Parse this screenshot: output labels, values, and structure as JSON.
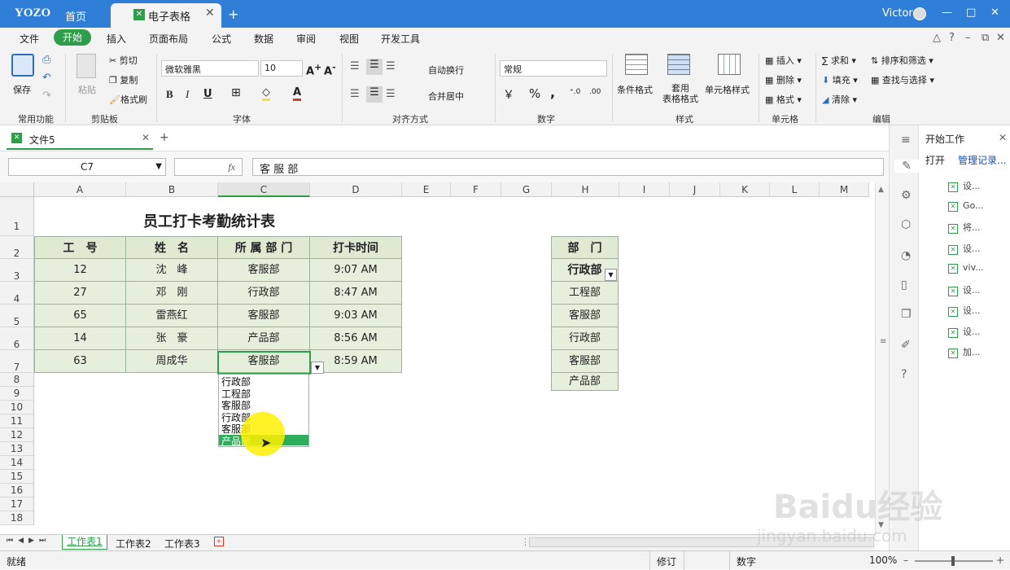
{
  "titlebar": {
    "logo": "YOZO",
    "home": "首页",
    "doc_tab": "电子表格",
    "new_tab": "+",
    "user": "Victor",
    "min": "—",
    "max": "□",
    "close": "✕"
  },
  "menu": {
    "items": [
      "文件",
      "开始",
      "插入",
      "页面布局",
      "公式",
      "数据",
      "审阅",
      "视图",
      "开发工具"
    ]
  },
  "ribbon": {
    "save": "保存",
    "paste": "粘贴",
    "cut": "剪切",
    "copy": "复制",
    "format_painter": "格式刷",
    "font_name": "微软雅黑",
    "font_size": "10",
    "bold": "B",
    "italic": "I",
    "underline": "U",
    "wrap": "自动换行",
    "merge": "合并居中",
    "number_format": "常规",
    "percent": "%",
    "comma": ",",
    "cond_format": "条件格式",
    "table_style": "套用\n表格格式",
    "cell_style": "单元格样式",
    "insert": "插入",
    "delete": "删除",
    "format": "格式",
    "sum": "求和",
    "fill": "填充",
    "clear": "清除",
    "sort": "排序和筛选",
    "find": "查找与选择",
    "groups": [
      "常用功能",
      "剪贴板",
      "字体",
      "对齐方式",
      "数字",
      "样式",
      "单元格",
      "编辑"
    ]
  },
  "filetab": {
    "name": "文件5",
    "close": "✕",
    "add": "+"
  },
  "formula": {
    "cellref": "C7",
    "fx": "fx",
    "value": "客 服 部"
  },
  "grid": {
    "columns": [
      "A",
      "B",
      "C",
      "D",
      "E",
      "F",
      "G",
      "H",
      "I",
      "J",
      "K",
      "L",
      "M"
    ],
    "rows": [
      "1",
      "2",
      "3",
      "4",
      "5",
      "6",
      "7",
      "8",
      "9",
      "10",
      "11",
      "12",
      "13",
      "14",
      "15",
      "16",
      "17",
      "18"
    ],
    "title": "员工打卡考勤统计表",
    "headers": [
      "工　号",
      "姓　名",
      "所 属 部 门",
      "打卡时间"
    ],
    "data": [
      [
        "12",
        "沈　峰",
        "客服部",
        "9:07 AM"
      ],
      [
        "27",
        "邓　刚",
        "行政部",
        "8:47 AM"
      ],
      [
        "65",
        "雷燕红",
        "客服部",
        "9:03 AM"
      ],
      [
        "14",
        "张　豪",
        "产品部",
        "8:56 AM"
      ],
      [
        "63",
        "周成华",
        "客服部",
        "8:59 AM"
      ]
    ],
    "dept_header": "部　门",
    "dept_list": [
      "行政部",
      "工程部",
      "客服部",
      "行政部",
      "客服部",
      "产品部"
    ]
  },
  "dropdown": {
    "items": [
      "行政部",
      "工程部",
      "客服部",
      "行政部",
      "客服部",
      "产品部"
    ],
    "selected_index": 5
  },
  "panel": {
    "title": "开始工作",
    "open": "打开",
    "manage": "管理记录...",
    "items": [
      "设...",
      "Go...",
      "将...",
      "设...",
      "viv...",
      "设...",
      "设...",
      "设...",
      "加..."
    ]
  },
  "sheets": [
    "工作表1",
    "工作表2",
    "工作表3"
  ],
  "status": {
    "ready": "就绪",
    "revise": "修订",
    "number": "数字",
    "zoom": "100%"
  },
  "watermark": {
    "text": "Baidu经验",
    "url": "jingyan.baidu.com"
  },
  "colors": {
    "titlebar": "#2f7fd9",
    "accent": "#2e9e4a",
    "cellfill": "#e6efdc"
  }
}
